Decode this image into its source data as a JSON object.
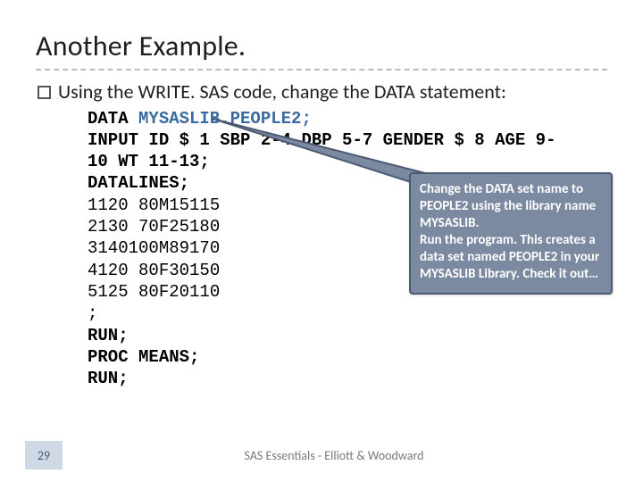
{
  "title": "Another Example.",
  "bullet": "Using the WRITE. SAS code, change the DATA statement:",
  "code": {
    "l1a": "DATA ",
    "l1b": "MYSASLIB.PEOPLE2;",
    "l2": "INPUT ID $ 1 SBP 2-4 DBP 5-7 GENDER $ 8 AGE 9-\n10 WT 11-13;",
    "l3": "DATALINES;",
    "d1": "1120 80M15115",
    "d2": "2130 70F25180",
    "d3": "3140100M89170",
    "d4": "4120 80F30150",
    "d5": "5125 80F20110",
    "semi": ";",
    "r1": "RUN;",
    "pm": "PROC MEANS;",
    "r2": "RUN;"
  },
  "callout": "Change the DATA set name to PEOPLE2 using the library name MYSASLIB.\nRun the program. This creates a data set named PEOPLE2 in your MYSASLIB Library. Check it out…",
  "footer": {
    "page": "29",
    "text": "SAS Essentials - Elliott & Woodward"
  }
}
